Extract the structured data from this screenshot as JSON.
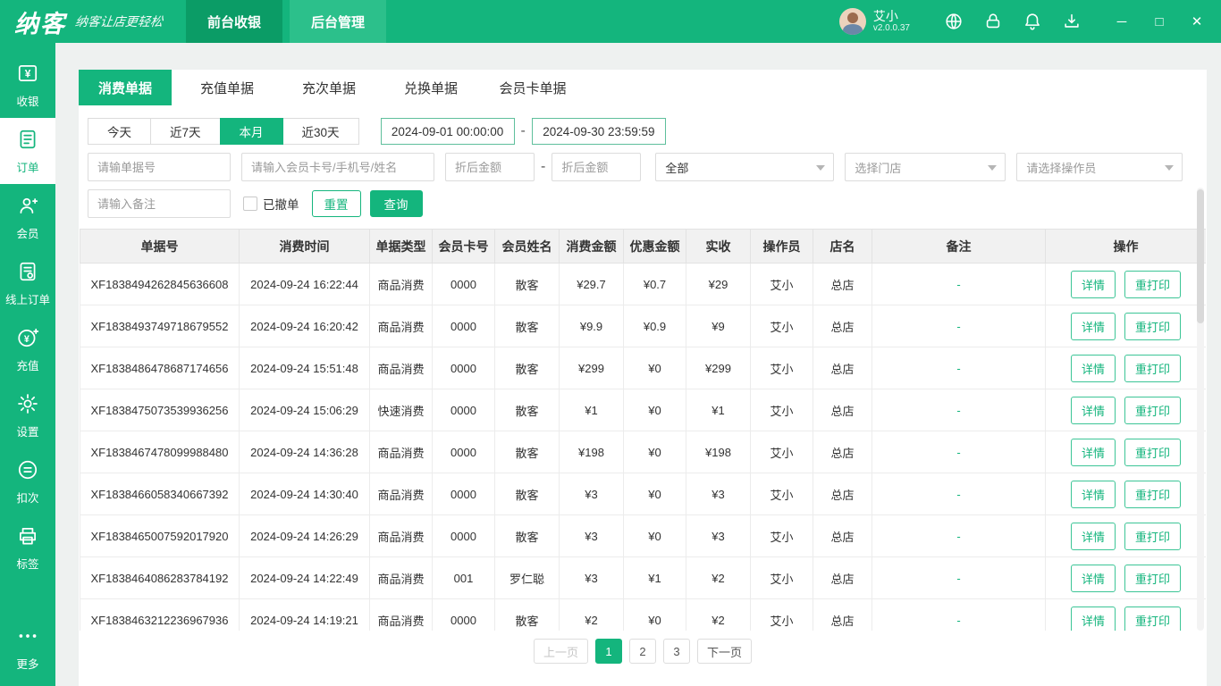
{
  "topbar": {
    "logo": "纳客",
    "slogan": "纳客让店更轻松",
    "tabs": [
      {
        "label": "前台收银"
      },
      {
        "label": "后台管理"
      }
    ],
    "user": {
      "name": "艾小",
      "version": "v2.0.0.37"
    },
    "icons": [
      "remote-assist-icon",
      "lock-icon",
      "bell-icon",
      "download-icon"
    ],
    "window_controls": {
      "minimize": "─",
      "maximize": "□",
      "close": "✕"
    }
  },
  "sidebar": {
    "items": [
      {
        "label": "收银",
        "icon": "cashier-icon"
      },
      {
        "label": "订单",
        "icon": "order-icon",
        "active": true
      },
      {
        "label": "会员",
        "icon": "member-icon"
      },
      {
        "label": "线上订单",
        "icon": "online-order-icon"
      },
      {
        "label": "充值",
        "icon": "recharge-icon"
      },
      {
        "label": "设置",
        "icon": "settings-icon"
      },
      {
        "label": "扣次",
        "icon": "deduct-icon"
      },
      {
        "label": "标签",
        "icon": "label-printer-icon"
      },
      {
        "label": "更多",
        "icon": "more-icon"
      }
    ]
  },
  "doc_tabs": {
    "items": [
      "消费单据",
      "充值单据",
      "充次单据",
      "兑换单据",
      "会员卡单据"
    ],
    "active_index": 0
  },
  "filters": {
    "quick_ranges": [
      "今天",
      "近7天",
      "本月",
      "近30天"
    ],
    "active_range": "本月",
    "date_from": "2024-09-01 00:00:00",
    "date_to": "2024-09-30 23:59:59",
    "separator": "-",
    "order_no_placeholder": "请输单据号",
    "member_placeholder": "请输入会员卡号/手机号/姓名",
    "amount_min_placeholder": "折后金额",
    "amount_max_placeholder": "折后金额",
    "type_select_value": "全部",
    "store_select_placeholder": "选择门店",
    "operator_select_placeholder": "请选择操作员",
    "remark_placeholder": "请输入备注",
    "cancelled_checkbox_label": "已撤单",
    "reset_label": "重置",
    "search_label": "查询"
  },
  "table": {
    "headers": [
      "单据号",
      "消费时间",
      "单据类型",
      "会员卡号",
      "会员姓名",
      "消费金额",
      "优惠金额",
      "实收",
      "操作员",
      "店名",
      "备注",
      "操作"
    ],
    "detail_label": "详情",
    "reprint_label": "重打印",
    "rows": [
      [
        "XF1838494262845636608",
        "2024-09-24 16:22:44",
        "商品消费",
        "0000",
        "散客",
        "¥29.7",
        "¥0.7",
        "¥29",
        "艾小",
        "总店",
        "-"
      ],
      [
        "XF1838493749718679552",
        "2024-09-24 16:20:42",
        "商品消费",
        "0000",
        "散客",
        "¥9.9",
        "¥0.9",
        "¥9",
        "艾小",
        "总店",
        "-"
      ],
      [
        "XF1838486478687174656",
        "2024-09-24 15:51:48",
        "商品消费",
        "0000",
        "散客",
        "¥299",
        "¥0",
        "¥299",
        "艾小",
        "总店",
        "-"
      ],
      [
        "XF1838475073539936256",
        "2024-09-24 15:06:29",
        "快速消费",
        "0000",
        "散客",
        "¥1",
        "¥0",
        "¥1",
        "艾小",
        "总店",
        "-"
      ],
      [
        "XF1838467478099988480",
        "2024-09-24 14:36:28",
        "商品消费",
        "0000",
        "散客",
        "¥198",
        "¥0",
        "¥198",
        "艾小",
        "总店",
        "-"
      ],
      [
        "XF1838466058340667392",
        "2024-09-24 14:30:40",
        "商品消费",
        "0000",
        "散客",
        "¥3",
        "¥0",
        "¥3",
        "艾小",
        "总店",
        "-"
      ],
      [
        "XF1838465007592017920",
        "2024-09-24 14:26:29",
        "商品消费",
        "0000",
        "散客",
        "¥3",
        "¥0",
        "¥3",
        "艾小",
        "总店",
        "-"
      ],
      [
        "XF1838464086283784192",
        "2024-09-24 14:22:49",
        "商品消费",
        "001",
        "罗仁聪",
        "¥3",
        "¥1",
        "¥2",
        "艾小",
        "总店",
        "-"
      ],
      [
        "XF1838463212236967936",
        "2024-09-24 14:19:21",
        "商品消费",
        "0000",
        "散客",
        "¥2",
        "¥0",
        "¥2",
        "艾小",
        "总店",
        "-"
      ]
    ]
  },
  "pagination": {
    "prev_label": "上一页",
    "pages": [
      "1",
      "2",
      "3"
    ],
    "active_page": "1",
    "next_label": "下一页"
  }
}
